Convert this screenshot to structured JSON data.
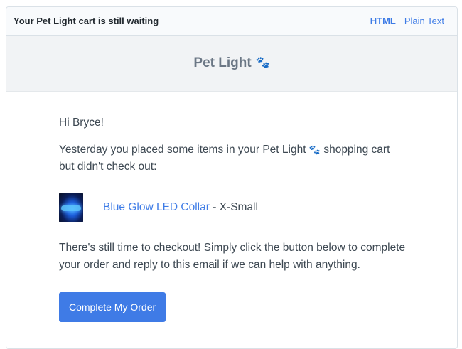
{
  "header": {
    "subject": "Your Pet Light cart is still waiting",
    "view_html": "HTML",
    "view_plain": "Plain Text"
  },
  "brand": {
    "name": "Pet Light",
    "paw": "🐾"
  },
  "email": {
    "greeting": "Hi Bryce!",
    "intro_before": "Yesterday you placed some items in your Pet Light",
    "intro_paw": "🐾",
    "intro_after": " shopping cart but didn't check out:",
    "product": {
      "name": "Blue Glow LED Collar",
      "separator": " - ",
      "variant": "X-Small"
    },
    "body": "There's still time to checkout! Simply click the button below to complete your order and reply to this email if we can help with anything.",
    "cta_label": "Complete My Order"
  },
  "colors": {
    "accent": "#3f7be6",
    "band": "#f1f3f5"
  }
}
